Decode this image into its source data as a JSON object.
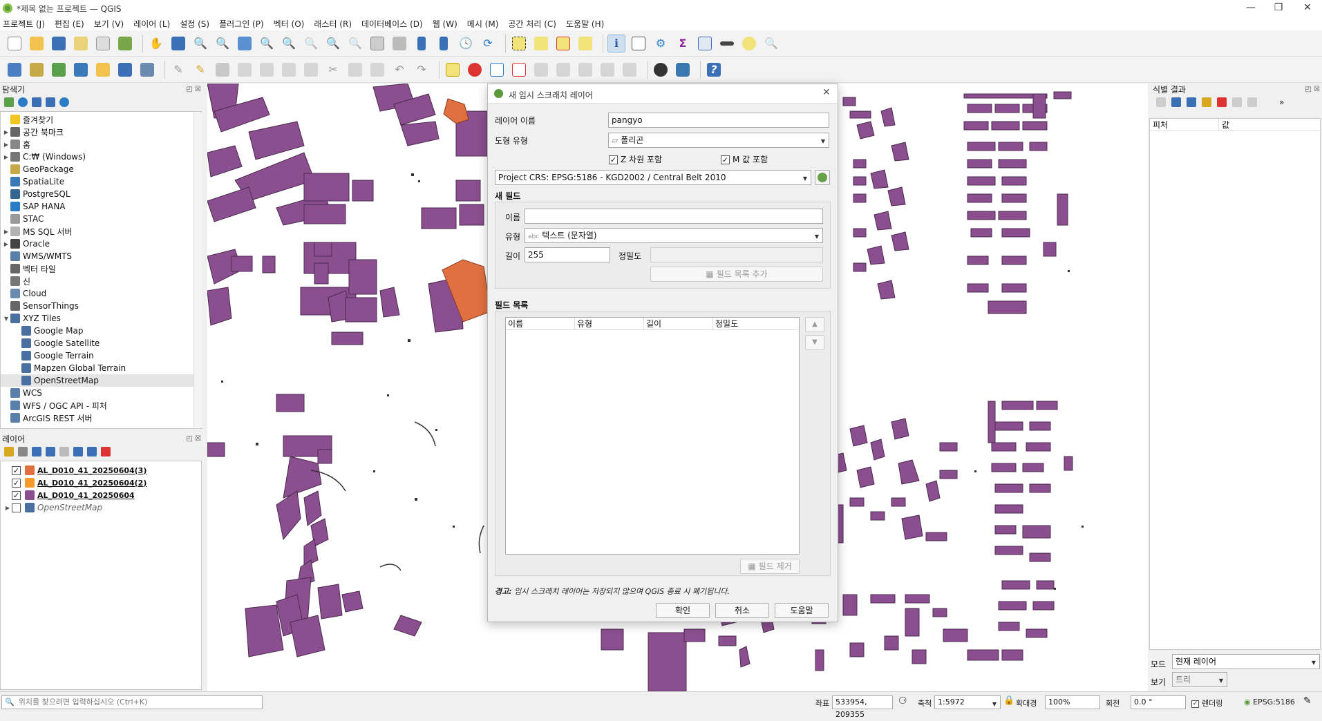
{
  "window": {
    "title": "*제목 없는 프로젝트 — QGIS",
    "controls": [
      "—",
      "❐",
      "✕"
    ]
  },
  "menu": [
    "프로젝트 (J)",
    "편집 (E)",
    "보기 (V)",
    "레이어 (L)",
    "설정 (S)",
    "플러그인 (P)",
    "벡터 (O)",
    "래스터 (R)",
    "데이터베이스 (D)",
    "웹 (W)",
    "메시 (M)",
    "공간 처리 (C)",
    "도움말 (H)"
  ],
  "browser": {
    "title": "탐색기",
    "items": [
      {
        "label": "즐겨찾기",
        "icon": "star-icon",
        "color": "#f3c521",
        "arrow": ""
      },
      {
        "label": "공간 북마크",
        "icon": "bookmark-icon",
        "color": "#666",
        "arrow": "▶"
      },
      {
        "label": "홈",
        "icon": "home-icon",
        "color": "#888",
        "arrow": "▶"
      },
      {
        "label": "C:₩ (Windows)",
        "icon": "drive-icon",
        "color": "#777",
        "arrow": "▶"
      },
      {
        "label": "GeoPackage",
        "icon": "geopackage-icon",
        "color": "#c8a94a",
        "arrow": ""
      },
      {
        "label": "SpatiaLite",
        "icon": "spatialite-icon",
        "color": "#3a7ab8",
        "arrow": ""
      },
      {
        "label": "PostgreSQL",
        "icon": "postgresql-icon",
        "color": "#336791",
        "arrow": ""
      },
      {
        "label": "SAP HANA",
        "icon": "saphana-icon",
        "color": "#2a7cc7",
        "arrow": ""
      },
      {
        "label": "STAC",
        "icon": "stac-icon",
        "color": "#999",
        "arrow": ""
      },
      {
        "label": "MS SQL 서버",
        "icon": "mssql-icon",
        "color": "#b3b3b3",
        "arrow": "▶"
      },
      {
        "label": "Oracle",
        "icon": "oracle-icon",
        "color": "#444",
        "arrow": "▶"
      },
      {
        "label": "WMS/WMTS",
        "icon": "wms-icon",
        "color": "#5a7fa8",
        "arrow": ""
      },
      {
        "label": "벡터 타일",
        "icon": "vector-tile-icon",
        "color": "#666",
        "arrow": ""
      },
      {
        "label": "신",
        "icon": "scene-icon",
        "color": "#777",
        "arrow": ""
      },
      {
        "label": "Cloud",
        "icon": "cloud-icon",
        "color": "#6a8ab0",
        "arrow": ""
      },
      {
        "label": "SensorThings",
        "icon": "sensor-icon",
        "color": "#666",
        "arrow": ""
      },
      {
        "label": "XYZ Tiles",
        "icon": "xyz-tiles-icon",
        "color": "#4a6fa0",
        "arrow": "▼"
      },
      {
        "label": "Google Map",
        "icon": "tile-grid-icon",
        "color": "#4a6fa0",
        "arrow": "",
        "indent": 1
      },
      {
        "label": "Google Satellite",
        "icon": "tile-grid-icon",
        "color": "#4a6fa0",
        "arrow": "",
        "indent": 1
      },
      {
        "label": "Google Terrain",
        "icon": "tile-grid-icon",
        "color": "#4a6fa0",
        "arrow": "",
        "indent": 1
      },
      {
        "label": "Mapzen Global Terrain",
        "icon": "tile-grid-icon",
        "color": "#4a6fa0",
        "arrow": "",
        "indent": 1
      },
      {
        "label": "OpenStreetMap",
        "icon": "tile-grid-icon",
        "color": "#4a6fa0",
        "arrow": "",
        "indent": 1,
        "selected": true
      },
      {
        "label": "WCS",
        "icon": "wcs-icon",
        "color": "#5a7fa8",
        "arrow": ""
      },
      {
        "label": "WFS / OGC API - 피처",
        "icon": "wfs-icon",
        "color": "#5a7fa8",
        "arrow": ""
      },
      {
        "label": "ArcGIS REST 서버",
        "icon": "arcgis-icon",
        "color": "#5a7fa8",
        "arrow": ""
      }
    ]
  },
  "layers": {
    "title": "레이어",
    "items": [
      {
        "label": "AL_D010_41_20250604(3)",
        "color": "#e07040",
        "checked": true,
        "bold": true
      },
      {
        "label": "AL_D010_41_20250604(2)",
        "color": "#f59a2a",
        "checked": true,
        "bold": true
      },
      {
        "label": "AL_D010_41_20250604",
        "color": "#8b4f8f",
        "checked": true,
        "bold": true
      },
      {
        "label": "OpenStreetMap",
        "color": "#4a6fa0",
        "checked": false,
        "bold": false
      }
    ]
  },
  "identify": {
    "title": "식별 결과",
    "col_feature": "피처",
    "col_value": "값",
    "mode_label": "모드",
    "mode_value": "현재 레이어",
    "view_label": "보기",
    "view_value": "트리"
  },
  "dialog": {
    "title": "새 임시 스크래치 레이어",
    "layer_name_label": "레이어 이름",
    "layer_name_value": "pangyo",
    "geom_type_label": "도형 유형",
    "geom_type_value": "폴리곤",
    "z_label": "Z 차원 포함",
    "m_label": "M 값 포함",
    "crs_value": "Project CRS: EPSG:5186 - KGD2002 / Central Belt 2010",
    "new_field_title": "새 필드",
    "name_label": "이름",
    "name_value": "",
    "type_label": "유형",
    "type_prefix": "abc",
    "type_value": "텍스트 (문자열)",
    "length_label": "길이",
    "length_value": "255",
    "precision_label": "정밀도",
    "precision_value": "",
    "add_field_button": "필드 목록 추가",
    "field_list_title": "필드 목록",
    "columns": [
      "이름",
      "유형",
      "길이",
      "정밀도"
    ],
    "remove_field_button": "필드 제거",
    "warning_prefix": "경고:",
    "warning_text": "임시 스크래치 레이어는 저장되지 않으며 QGIS 종료 시 폐기됩니다.",
    "ok_button": "확인",
    "cancel_button": "취소",
    "help_button": "도움말"
  },
  "statusbar": {
    "locate_placeholder": "위치를 찾으려면 입력하십시오 (Ctrl+K)",
    "coord_label": "좌표",
    "coord_value": "533954, 209355",
    "scale_label": "축척",
    "scale_value": "1:5972",
    "magnifier_label": "확대경",
    "magnifier_value": "100%",
    "rotation_label": "회전",
    "rotation_value": "0.0 °",
    "render_label": "렌더링",
    "crs_value": "EPSG:5186"
  },
  "colors": {
    "building": "#8b4f8f",
    "building_orange": "#e07040",
    "accent": "#5a9a3a"
  }
}
